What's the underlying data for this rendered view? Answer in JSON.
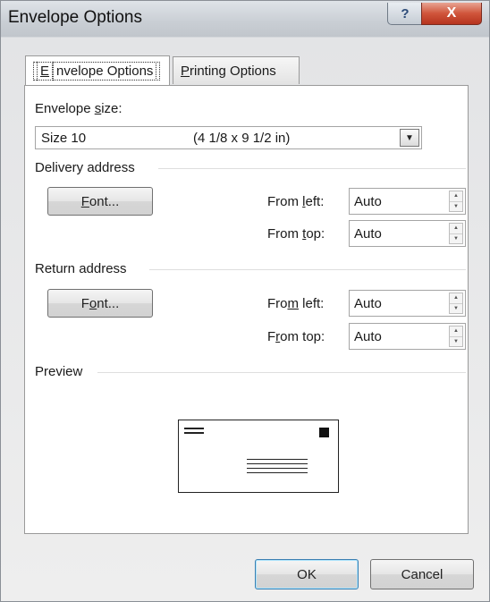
{
  "window": {
    "title": "Envelope Options",
    "help_glyph": "?",
    "close_glyph": "X"
  },
  "tabs": [
    {
      "label_u": "E",
      "label_rest": "nvelope Options"
    },
    {
      "label_u": "P",
      "label_rest": "rinting Options"
    }
  ],
  "envelope_size": {
    "label_pre": "Envelope ",
    "label_u": "s",
    "label_post": "ize:",
    "selected_name": "Size 10",
    "selected_dims": "(4 1/8 x 9 1/2 in)"
  },
  "delivery": {
    "group_label": "Delivery address",
    "font_pre": "",
    "font_u": "F",
    "font_post": "ont...",
    "from_left_pre": "From ",
    "from_left_u": "l",
    "from_left_post": "eft:",
    "from_left_value": "Auto",
    "from_top_pre": "From ",
    "from_top_u": "t",
    "from_top_post": "op:",
    "from_top_value": "Auto"
  },
  "return": {
    "group_label": "Return address",
    "font_pre": "F",
    "font_u": "o",
    "font_post": "nt...",
    "from_left_pre": "Fro",
    "from_left_u": "m",
    "from_left_post": " left:",
    "from_left_value": "Auto",
    "from_top_pre": "F",
    "from_top_u": "r",
    "from_top_post": "om top:",
    "from_top_value": "Auto"
  },
  "preview": {
    "group_label": "Preview"
  },
  "buttons": {
    "ok": "OK",
    "cancel": "Cancel"
  },
  "glyphs": {
    "dropdown": "▼",
    "up": "▲",
    "down": "▼"
  }
}
